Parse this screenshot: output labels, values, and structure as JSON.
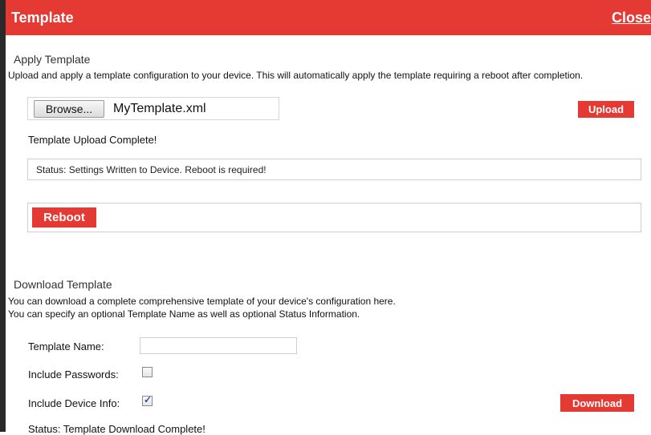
{
  "header": {
    "title": "Template",
    "close_label": "Close"
  },
  "apply": {
    "section_title": "Apply Template",
    "description": "Upload and apply a template configuration to your device. This will automatically apply the template requiring a reboot after completion.",
    "browse_label": "Browse...",
    "file_name": "MyTemplate.xml",
    "upload_label": "Upload",
    "upload_status": "Template Upload Complete!",
    "status_text": "Status: Settings Written to Device. Reboot is required!",
    "reboot_label": "Reboot"
  },
  "download": {
    "section_title": "Download Template",
    "description_line1": "You can download a complete comprehensive template of your device's configuration here.",
    "description_line2": "You can specify an optional Template Name as well as optional Status Information.",
    "template_name_label": "Template Name:",
    "template_name_value": "",
    "include_passwords_label": "Include Passwords:",
    "include_passwords_checked": false,
    "include_device_info_label": "Include Device Info:",
    "include_device_info_checked": true,
    "checkmark": "✓",
    "download_label": "Download",
    "status_text": "Status: Template Download Complete!"
  },
  "colors": {
    "accent": "#e53a33",
    "border": "#cfcfcf",
    "check": "#2b4f9b"
  }
}
